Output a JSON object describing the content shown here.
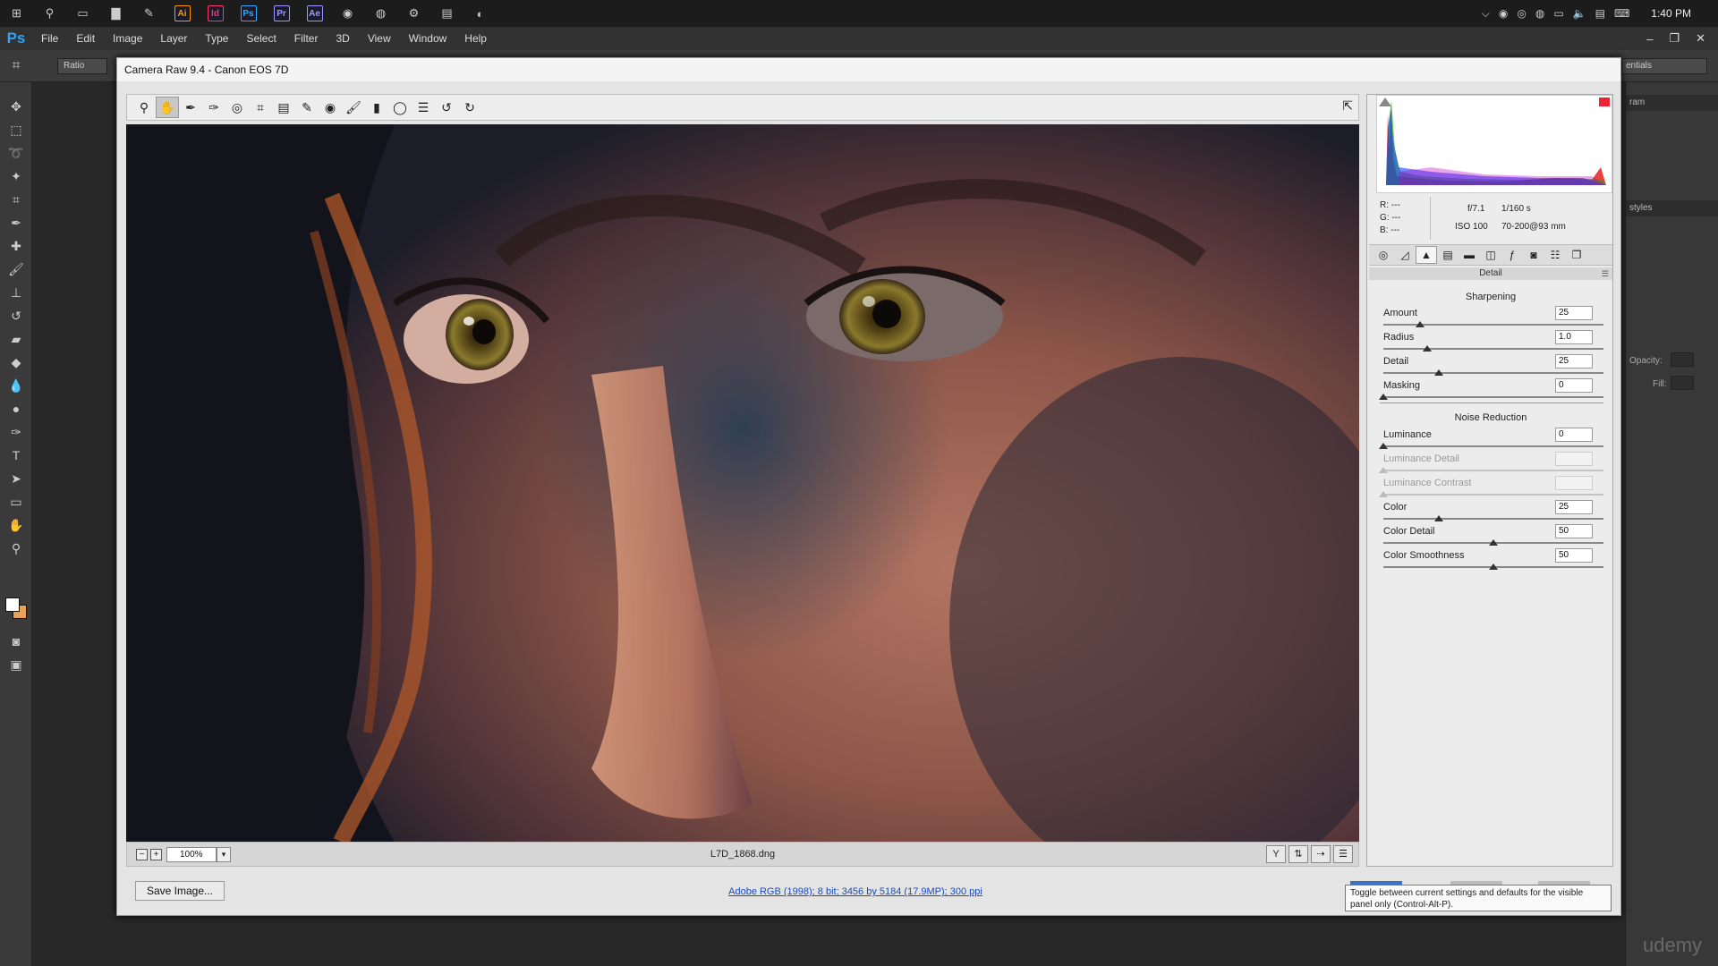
{
  "taskbar": {
    "apps": [
      {
        "name": "windows-start",
        "glyph": "⊞"
      },
      {
        "name": "search",
        "glyph": "⚲"
      },
      {
        "name": "task-view",
        "glyph": "▭"
      },
      {
        "name": "file-explorer",
        "glyph": "▇"
      },
      {
        "name": "feather-app",
        "glyph": "✎"
      },
      {
        "name": "illustrator",
        "glyph": "Ai",
        "color": "#ff9a00"
      },
      {
        "name": "indesign",
        "glyph": "Id",
        "color": "#ff3366"
      },
      {
        "name": "photoshop",
        "glyph": "Ps",
        "color": "#31a8ff"
      },
      {
        "name": "premiere",
        "glyph": "Pr",
        "color": "#9999ff"
      },
      {
        "name": "after-effects",
        "glyph": "Ae",
        "color": "#9999ff"
      },
      {
        "name": "browser-1",
        "glyph": "◉"
      },
      {
        "name": "chrome",
        "glyph": "◍"
      },
      {
        "name": "app-settings",
        "glyph": "⚙"
      },
      {
        "name": "notes-app",
        "glyph": "▤"
      },
      {
        "name": "app-round",
        "glyph": "◐"
      }
    ],
    "clock": "1:40 PM"
  },
  "menubar": {
    "logo": "Ps",
    "items": [
      "File",
      "Edit",
      "Image",
      "Layer",
      "Type",
      "Select",
      "Filter",
      "3D",
      "View",
      "Window",
      "Help"
    ]
  },
  "options": {
    "ratio": "Ratio",
    "workspace": "entials"
  },
  "dock": {
    "tab1": "ram",
    "tab2": "styles",
    "opacity_label": "Opacity:",
    "fill_label": "Fill:"
  },
  "dialog": {
    "title": "Camera Raw 9.4  -  Canon EOS 7D",
    "zoom": "100%",
    "filename": "L7D_1868.dng",
    "save_label": "Save Image...",
    "workflow": "Adobe RGB (1998); 8 bit; 3456 by 5184 (17.9MP); 300 ppi",
    "tooltip": "Toggle between current settings and defaults for the visible panel only (Control-Alt-P)."
  },
  "readout": {
    "r": "R:   ---",
    "g": "G:   ---",
    "b": "B:   ---",
    "aperture": "f/7.1",
    "shutter": "1/160 s",
    "iso": "ISO 100",
    "lens": "70-200@93 mm"
  },
  "panel": {
    "title": "Detail",
    "sharpening_title": "Sharpening",
    "noise_title": "Noise Reduction",
    "sharpening": [
      {
        "label": "Amount",
        "value": "25",
        "fraction": 0.167,
        "disabled": false
      },
      {
        "label": "Radius",
        "value": "1.0",
        "fraction": 0.2,
        "disabled": false
      },
      {
        "label": "Detail",
        "value": "25",
        "fraction": 0.25,
        "disabled": false
      },
      {
        "label": "Masking",
        "value": "0",
        "fraction": 0.0,
        "disabled": false
      }
    ],
    "noise": [
      {
        "label": "Luminance",
        "value": "0",
        "fraction": 0.0,
        "disabled": false
      },
      {
        "label": "Luminance Detail",
        "value": "",
        "fraction": 0.0,
        "disabled": true
      },
      {
        "label": "Luminance Contrast",
        "value": "",
        "fraction": 0.0,
        "disabled": true
      },
      {
        "label": "Color",
        "value": "25",
        "fraction": 0.25,
        "disabled": false
      },
      {
        "label": "Color Detail",
        "value": "50",
        "fraction": 0.5,
        "disabled": false
      },
      {
        "label": "Color Smoothness",
        "value": "50",
        "fraction": 0.5,
        "disabled": false
      }
    ]
  },
  "watermark": "udemy"
}
